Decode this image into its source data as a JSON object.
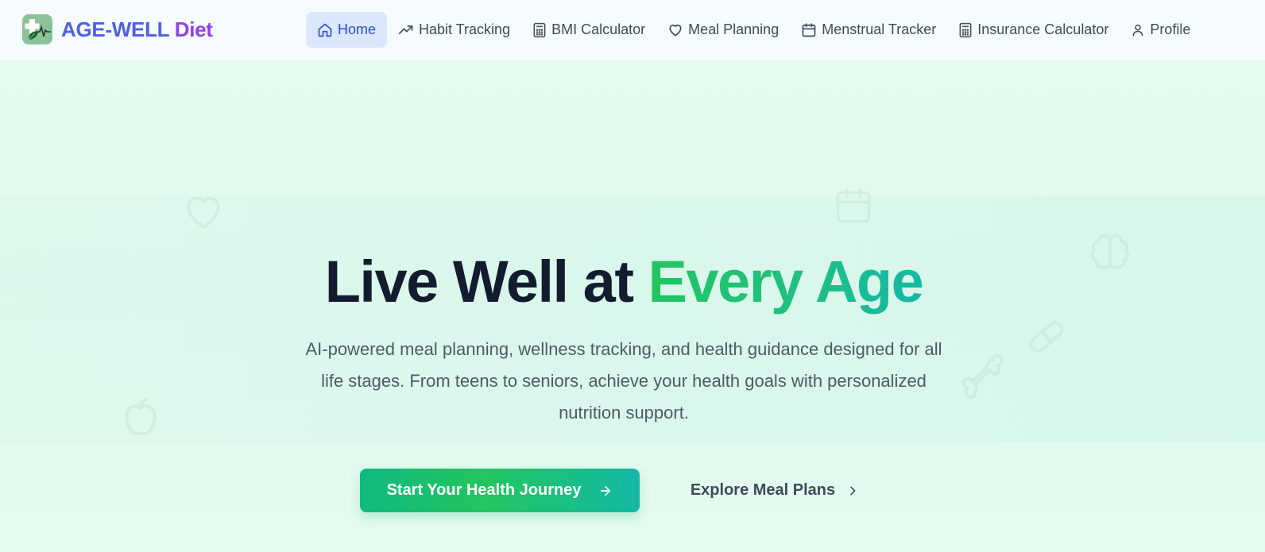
{
  "brand": {
    "name_part1": "AGE-WELL",
    "name_part2": "Diet",
    "logo_icon": "health-cross-leaf-icon"
  },
  "nav": {
    "items": [
      {
        "label": "Home",
        "icon": "home-icon",
        "active": true
      },
      {
        "label": "Habit Tracking",
        "icon": "trending-up-icon"
      },
      {
        "label": "BMI Calculator",
        "icon": "calculator-icon"
      },
      {
        "label": "Meal Planning",
        "icon": "heart-icon"
      },
      {
        "label": "Menstrual Tracker",
        "icon": "calendar-icon"
      },
      {
        "label": "Insurance Calculator",
        "icon": "calculator-icon"
      },
      {
        "label": "Profile",
        "icon": "user-icon"
      }
    ]
  },
  "hero": {
    "headline_main": "Live Well at",
    "headline_accent": "Every Age",
    "subtitle": "AI-powered meal planning, wellness tracking, and health guidance designed for all life stages. From teens to seniors, achieve your health goals with personalized nutrition support.",
    "primary_cta": "Start Your Health Journey",
    "secondary_cta": "Explore Meal Plans",
    "decorations": [
      "heart-icon",
      "calendar-icon",
      "brain-icon",
      "pill-icon",
      "bone-icon",
      "apple-icon"
    ]
  },
  "colors": {
    "brand_blue": "#4f5ee6",
    "brand_purple": "#9042e6",
    "accent_green": "#22c55e",
    "nav_active_bg": "#dbe7fb",
    "hero_bg": "#e3fbee"
  }
}
